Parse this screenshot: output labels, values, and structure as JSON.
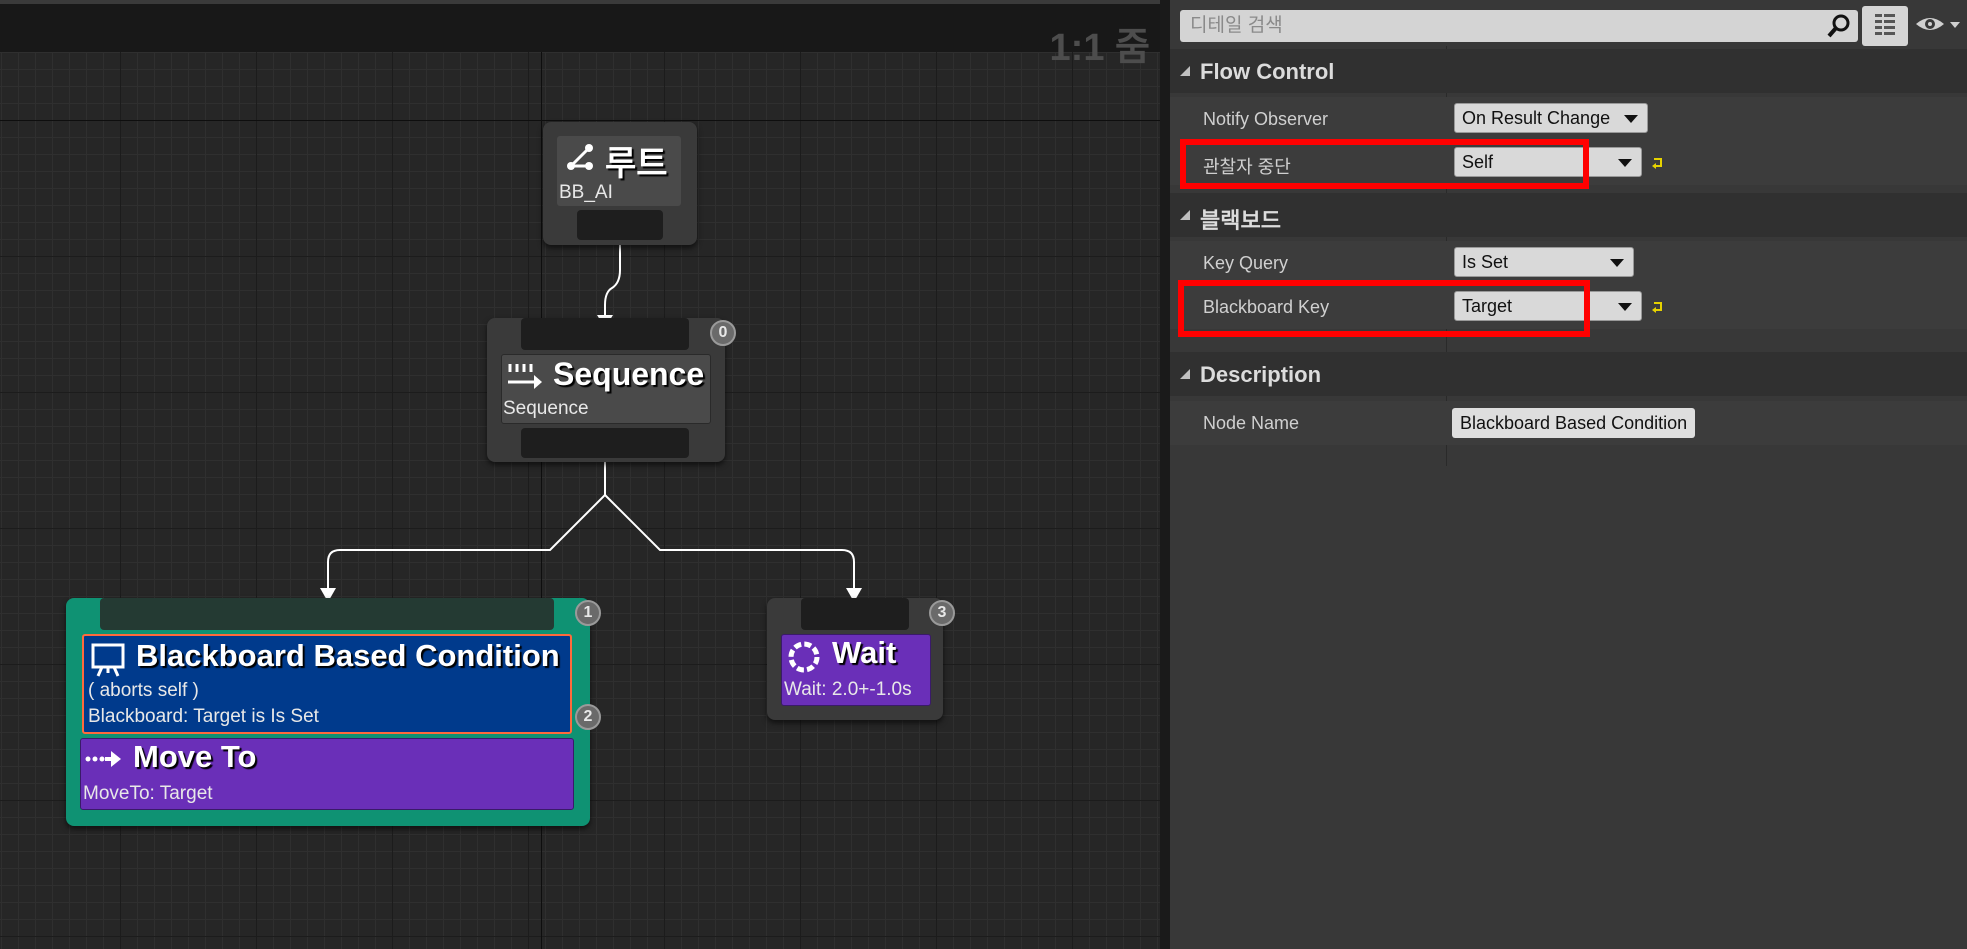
{
  "graph": {
    "zoom_label": "1:1 줌",
    "root": {
      "title": "루트",
      "subtitle": "BB_AI"
    },
    "sequence": {
      "title": "Sequence",
      "subtitle": "Sequence",
      "index": "0"
    },
    "blackboard_decorator": {
      "title": "Blackboard Based Condition",
      "line1": "( aborts self )",
      "line2": "Blackboard: Target is Is Set",
      "index": "2"
    },
    "move_to": {
      "title": "Move To",
      "subtitle": "MoveTo: Target",
      "index": "1"
    },
    "wait": {
      "title": "Wait",
      "subtitle": "Wait: 2.0+-1.0s",
      "index": "3"
    },
    "colors": {
      "decorator_blue": "#003a8c",
      "task_purple": "#6a2fb8",
      "selected_green": "#0f9273"
    }
  },
  "details": {
    "search_placeholder": "디테일 검색",
    "sections": {
      "flow_control": {
        "title": "Flow Control",
        "notify_observer_label": "Notify Observer",
        "notify_observer_value": "On Result Change",
        "observer_aborts_label": "관찰자 중단",
        "observer_aborts_value": "Self"
      },
      "blackboard": {
        "title": "블랙보드",
        "key_query_label": "Key Query",
        "key_query_value": "Is Set",
        "blackboard_key_label": "Blackboard Key",
        "blackboard_key_value": "Target"
      },
      "description": {
        "title": "Description",
        "node_name_label": "Node Name",
        "node_name_value": "Blackboard Based Condition"
      }
    },
    "colors": {
      "highlight": "#ff0000",
      "reset_arrow": "#e6d200"
    }
  }
}
